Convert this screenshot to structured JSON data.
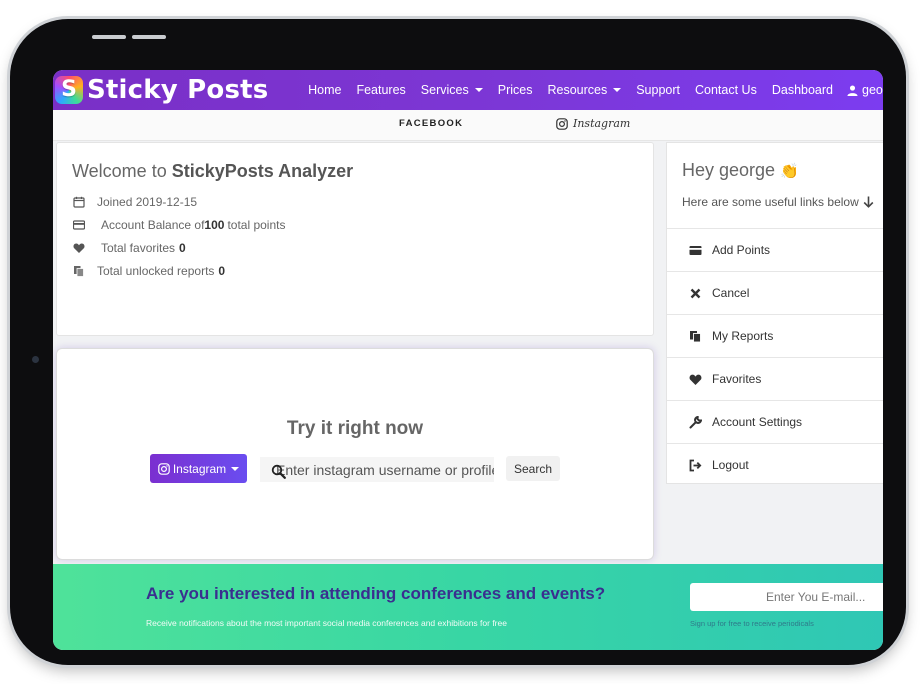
{
  "navbar": {
    "logo_letter": "S",
    "brand": "Sticky Posts",
    "links": [
      "Home",
      "Features",
      "Services",
      "Prices",
      "Resources",
      "Support",
      "Contact Us",
      "Dashboard"
    ],
    "user": "george"
  },
  "tabs": {
    "facebook": "FACEBOOK",
    "instagram": "Instagram"
  },
  "welcome": {
    "title_prefix": "Welcome to ",
    "title_bold": "StickyPosts Analyzer",
    "joined": "Joined 2019-12-15",
    "balance_prefix": "Account Balance of ",
    "balance_value": "100",
    "balance_suffix": " total points",
    "favorites_label": "Total favorites",
    "favorites_value": "0",
    "reports_label": "Total unlocked reports",
    "reports_value": "0"
  },
  "try": {
    "title": "Try it right now",
    "dropdown_label": "Instagram",
    "search_placeholder": "Enter instagram username or profile link",
    "search_button": "Search"
  },
  "sidebar": {
    "greeting": "Hey george",
    "greeting_emoji": "👏",
    "subtitle": "Here are some useful links below",
    "links": [
      {
        "label": "Add Points",
        "icon": "credit-card-icon"
      },
      {
        "label": "Cancel",
        "icon": "close-icon"
      },
      {
        "label": "My Reports",
        "icon": "copy-icon"
      },
      {
        "label": "Favorites",
        "icon": "heart-icon"
      },
      {
        "label": "Account Settings",
        "icon": "wrench-icon"
      },
      {
        "label": "Logout",
        "icon": "logout-icon"
      }
    ]
  },
  "footer": {
    "title": "Are you interested in attending conferences and events?",
    "subtitle": "Receive notifications about the most important social media conferences and exhibitions for free",
    "email_placeholder": "Enter You E-mail...",
    "hint": "Sign up for free to receive periodicals"
  },
  "colors": {
    "navbar": "#7b35d8",
    "footer_green": "#4fe29a",
    "footer_teal": "#2fc7b5",
    "footer_title": "#3a2f8f"
  }
}
